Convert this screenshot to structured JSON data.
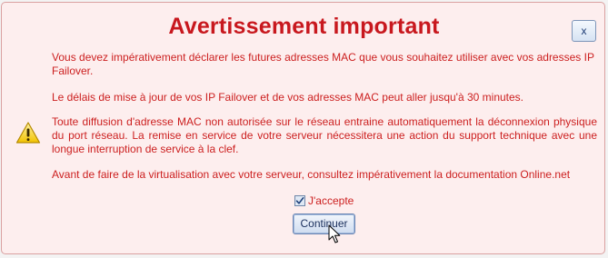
{
  "dialog": {
    "title": "Avertissement important",
    "close_label": "x",
    "paragraphs": [
      "Vous devez impérativement déclarer les futures adresses MAC que vous souhaitez utiliser avec vos adresses IP Failover.",
      "Le délais de mise à jour de vos IP Failover et de vos adresses MAC peut aller jusqu'à 30 minutes.",
      "Toute diffusion d'adresse MAC non autorisée sur le réseau entraine automatiquement la déconnexion physique du port réseau. La remise en service de votre serveur nécessitera une action du support technique avec une longue interruption de service à la clef.",
      "Avant de faire de la virtualisation avec votre serveur, consultez impérativement la documentation Online.net"
    ],
    "accept_label": "J'accepte",
    "accept_checked": true,
    "submit_label": "Continuer",
    "warning_icon": "warning-triangle-icon"
  },
  "colors": {
    "title": "#c8181e",
    "text": "#cc1f1f",
    "background": "#fdeeee",
    "border": "#d9a0a0",
    "button_border": "#6b86b3"
  }
}
